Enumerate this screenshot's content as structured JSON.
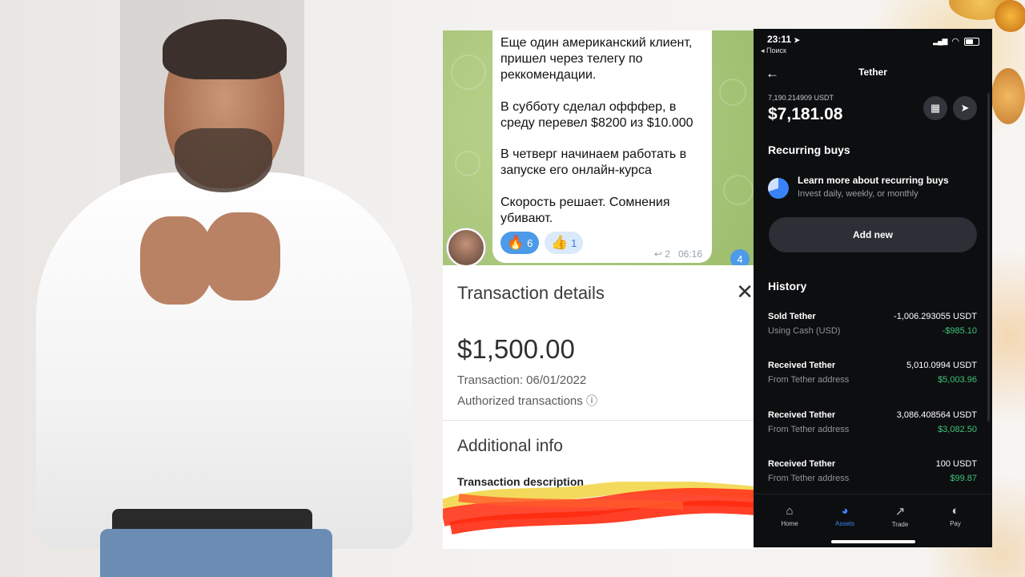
{
  "telegram": {
    "paragraphs": [
      "Еще один американский клиент, пришел через телегу по реккомендации.",
      "В субботу сделал офффер, в среду перевел $8200 из $10.000",
      "В четверг начинаем работать в запуске его онлайн-курса",
      "Скорость решает. Сомнения убивают."
    ],
    "reactions": [
      {
        "emoji": "🔥",
        "count": "6"
      },
      {
        "emoji": "👍",
        "count": "1"
      }
    ],
    "replies": "2",
    "time": "06:16",
    "unread_badge": "4"
  },
  "transaction": {
    "title": "Transaction details",
    "close": "✕",
    "amount": "$1,500.00",
    "date_line": "Transaction: 06/01/2022",
    "authorized": "Authorized transactions",
    "info_icon": "ⓘ",
    "additional_info": "Additional info",
    "description_label": "Transaction description"
  },
  "phone": {
    "status_time": "23:11",
    "status_back": "◂ Поиск",
    "title": "Tether",
    "balance_crypto": "7,190.214909 USDT",
    "balance_fiat": "$7,181.08",
    "recurring_title": "Recurring buys",
    "recurring_learn": "Learn more about recurring buys",
    "recurring_sub": "Invest daily, weekly, or monthly",
    "add_new": "Add new",
    "history_title": "History",
    "history": [
      {
        "title": "Sold Tether",
        "sub": "Using Cash (USD)",
        "amount": "-1,006.293055 USDT",
        "fiat": "-$985.10"
      },
      {
        "title": "Received Tether",
        "sub": "From Tether address",
        "amount": "5,010.0994 USDT",
        "fiat": "$5,003.96"
      },
      {
        "title": "Received Tether",
        "sub": "From Tether address",
        "amount": "3,086.408564 USDT",
        "fiat": "$3,082.50"
      },
      {
        "title": "Received Tether",
        "sub": "From Tether address",
        "amount": "100 USDT",
        "fiat": "$99.87"
      }
    ],
    "tabs": [
      "Home",
      "Assets",
      "Trade",
      "Pay"
    ],
    "accent": "#3b82f6",
    "positive_color": "#3cc47a"
  }
}
